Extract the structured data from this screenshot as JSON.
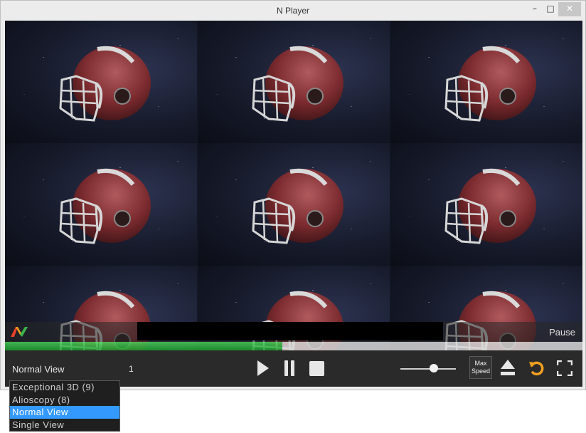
{
  "window": {
    "title": "N Player",
    "minimize_glyph": "–",
    "maximize_glyph": "□",
    "close_glyph": "✕"
  },
  "video": {
    "tile_count": 9,
    "subject_icon": "football-helmet"
  },
  "status": {
    "playback_state": "Pause",
    "progress_fraction": 0.48
  },
  "controls": {
    "view_mode": "Normal View",
    "view_value": "1",
    "volume_fraction": 0.6,
    "max_speed_line1": "Max",
    "max_speed_line2": "Speed",
    "icons": [
      "play-icon",
      "pause-icon",
      "stop-icon",
      "eject-icon",
      "repeat-icon",
      "fullscreen-icon"
    ]
  },
  "dropdown": {
    "options": [
      "Exceptional 3D (9)",
      "Alioscopy (8)",
      "Normal View",
      "Single View"
    ],
    "selected_index": 2
  },
  "colors": {
    "progress_green": "#2bb33b",
    "accent_orange": "#f0a020",
    "selection_blue": "#3399ff",
    "helmet_red": "#7a2a2e"
  }
}
